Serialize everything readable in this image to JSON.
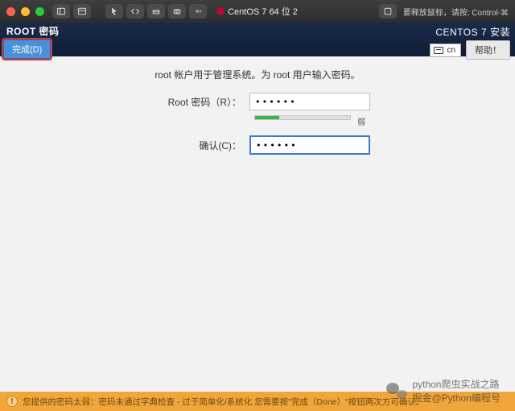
{
  "titlebar": {
    "vm_name": "CentOS 7 64 位 2",
    "release_hint": "要释放鼠标，请按: Control-⌘"
  },
  "header": {
    "spoke_title": "ROOT 密码",
    "done_label": "完成(D)",
    "install_title": "CENTOS 7 安装",
    "keyboard_layout": "cn",
    "help_label": "帮助！"
  },
  "form": {
    "description": "root 帐户用于管理系统。为 root 用户输入密码。",
    "password_label": "Root 密码（R）：",
    "password_value": "••••••",
    "confirm_label": "确认(C)：",
    "confirm_value": "••••••",
    "strength_label": "弱"
  },
  "warning": {
    "text": "您提供的密码太弱：密码未通过字典检查 - 过于简单化/系统化 您需要按\"完成（Done）\"按钮两次方可确认。"
  },
  "overlay": {
    "text1": "python爬虫实战之路",
    "text2": "掘金@Python编程号"
  }
}
